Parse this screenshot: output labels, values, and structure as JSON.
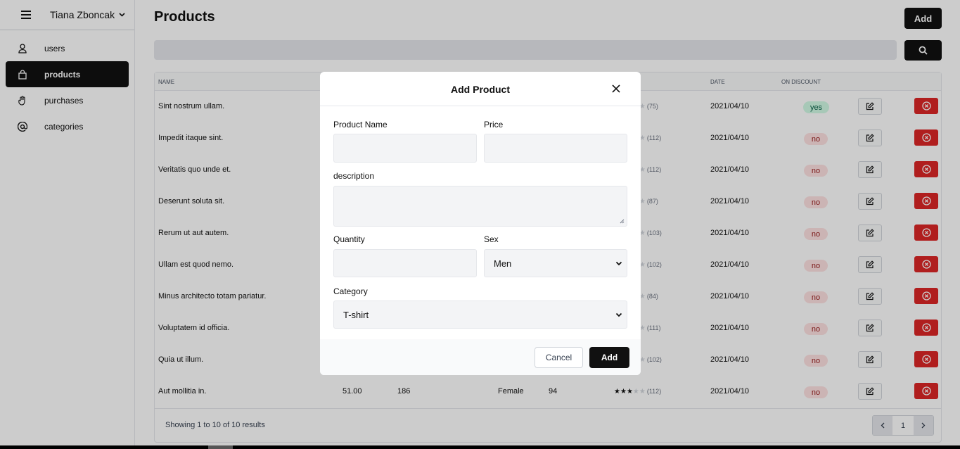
{
  "sidebar": {
    "user_name": "Tiana Zboncak",
    "items": [
      {
        "label": "users",
        "icon": "user-icon",
        "active": false
      },
      {
        "label": "products",
        "icon": "bag-icon",
        "active": true
      },
      {
        "label": "purchases",
        "icon": "hand-icon",
        "active": false
      },
      {
        "label": "categories",
        "icon": "at-icon",
        "active": false
      }
    ]
  },
  "header": {
    "title": "Products",
    "add_label": "Add"
  },
  "table": {
    "headers": [
      "NAME",
      "DATE",
      "ON DISCOUNT"
    ],
    "rows": [
      {
        "name": "Sint nostrum ullam.",
        "reviews": "(75)",
        "rating": 0,
        "date": "2021/04/10",
        "discount": "yes"
      },
      {
        "name": "Impedit itaque sint.",
        "reviews": "(112)",
        "rating": 0,
        "date": "2021/04/10",
        "discount": "no"
      },
      {
        "name": "Veritatis quo unde et.",
        "reviews": "(112)",
        "rating": 0,
        "date": "2021/04/10",
        "discount": "no"
      },
      {
        "name": "Deserunt soluta sit.",
        "reviews": "(87)",
        "rating": 0,
        "date": "2021/04/10",
        "discount": "no"
      },
      {
        "name": "Rerum ut aut autem.",
        "reviews": "(103)",
        "rating": 0,
        "date": "2021/04/10",
        "discount": "no"
      },
      {
        "name": "Ullam est quod nemo.",
        "reviews": "(102)",
        "rating": 0,
        "date": "2021/04/10",
        "discount": "no"
      },
      {
        "name": "Minus architecto totam pariatur.",
        "reviews": "(84)",
        "rating": 0,
        "date": "2021/04/10",
        "discount": "no"
      },
      {
        "name": "Voluptatem id officia.",
        "reviews": "(111)",
        "rating": 0,
        "date": "2021/04/10",
        "discount": "no"
      },
      {
        "name": "Quia ut illum.",
        "reviews": "(102)",
        "rating": 0,
        "date": "2021/04/10",
        "discount": "no"
      },
      {
        "name": "Aut mollitia in.",
        "price": "51.00",
        "quantity": "186",
        "sex": "Female",
        "sold": "94",
        "rating": 3,
        "reviews": "(112)",
        "date": "2021/04/10",
        "discount": "no"
      }
    ],
    "footer_info": "Showing 1 to 10 of 10 results",
    "page": "1"
  },
  "modal": {
    "title": "Add Product",
    "product_name_label": "Product Name",
    "price_label": "Price",
    "description_label": "description",
    "quantity_label": "Quantity",
    "sex_label": "Sex",
    "sex_value": "Men",
    "category_label": "Category",
    "category_value": "T-shirt",
    "cancel_label": "Cancel",
    "add_label": "Add"
  },
  "colors": {
    "accent": "#111111",
    "danger": "#dc2626",
    "yes_bg": "#d1fae5",
    "no_bg": "#fee2e2"
  }
}
